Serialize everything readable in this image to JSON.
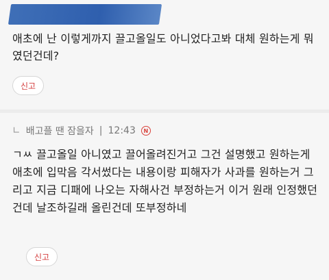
{
  "comment": {
    "text": "애초에 난 이렇게까지 끌고올일도 아니었다고봐 대체 원하는게 뭐였던건데?",
    "report_label": "신고"
  },
  "reply": {
    "author": "배고플 땐 잠을자",
    "time": "12:43",
    "new_badge": "N",
    "text": "ㄱㅆ 끌고올일 아니였고 끌어올려진거고 그건 설명했고 원하는게 애초에 입막음 각서썼다는 내용이랑 피해자가 사과를 원하는거 그리고 지금 디패에 나오는 자해사건 부정하는거 이거 원래 인정했던건데 날조하길래 올린건데 또부정하네",
    "report_label": "신고"
  }
}
